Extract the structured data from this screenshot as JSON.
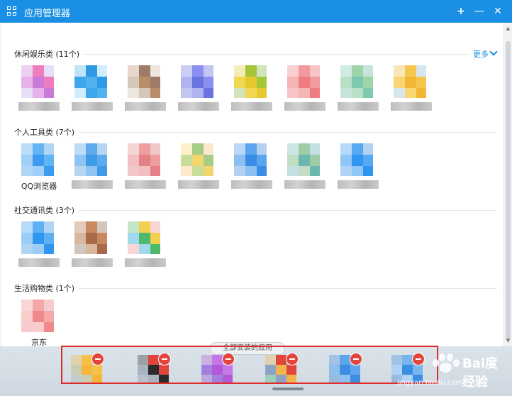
{
  "window": {
    "title": "应用管理器",
    "new_btn": "+",
    "minimize_btn": "—",
    "close_btn": "✕"
  },
  "sections": [
    {
      "title": "休闲娱乐类 (11个)",
      "more": "更多",
      "apps": [
        {
          "label": "",
          "palette": [
            "#c97ad6",
            "#f07cc0",
            "#b9a0e8",
            "#e8b0ea"
          ]
        },
        {
          "label": "",
          "palette": [
            "#4fb3ee",
            "#2e9ae6",
            "#7cc8f5",
            "#3da6ec"
          ]
        },
        {
          "label": "",
          "palette": [
            "#b98d6a",
            "#9d7b66",
            "#cab6a4",
            "#d4c6b9"
          ]
        },
        {
          "label": "",
          "palette": [
            "#6a74e0",
            "#8a8ff0",
            "#4f5dd8",
            "#b0b5f2"
          ]
        },
        {
          "label": "",
          "palette": [
            "#e6c830",
            "#a3c63a",
            "#7db33a",
            "#f2d850"
          ]
        },
        {
          "label": "",
          "palette": [
            "#ee7c80",
            "#f29a9c",
            "#e85a64",
            "#f5b5b5"
          ]
        },
        {
          "label": "",
          "palette": [
            "#7ec8b0",
            "#9ed4a8",
            "#5fb39b",
            "#b8e0c4"
          ]
        },
        {
          "label": "",
          "palette": [
            "#f2b735",
            "#f4c84e",
            "#8fb8cf",
            "#f8d674"
          ]
        }
      ]
    },
    {
      "title": "个人工具类 (7个)",
      "apps": [
        {
          "label": "QQ浏览器",
          "palette": [
            "#3a9bef",
            "#62b4f4",
            "#1d84e6",
            "#9fd0f8"
          ]
        },
        {
          "label": "",
          "palette": [
            "#3f9be8",
            "#5cabee",
            "#2e86d8",
            "#8fc3f2"
          ]
        },
        {
          "label": "",
          "palette": [
            "#e58086",
            "#ef9ea0",
            "#db5f68",
            "#f4bfc0"
          ]
        },
        {
          "label": "",
          "palette": [
            "#f2d66a",
            "#a6cc88",
            "#f0c46a",
            "#c9dd9a"
          ]
        },
        {
          "label": "",
          "palette": [
            "#3a8de4",
            "#5aa5ee",
            "#2a78d4",
            "#8cc0f2"
          ]
        },
        {
          "label": "",
          "palette": [
            "#6ab8b0",
            "#9fcca4",
            "#4fa3a8",
            "#c2ddc4"
          ]
        },
        {
          "label": "",
          "palette": [
            "#2f95ee",
            "#55aaf2",
            "#1c82e0",
            "#8ec6f6"
          ]
        }
      ]
    },
    {
      "title": "社交通讯类 (3个)",
      "apps": [
        {
          "label": "",
          "palette": [
            "#2f95ee",
            "#5eb0f4",
            "#1f84e2",
            "#9ccdf8"
          ]
        },
        {
          "label": "",
          "palette": [
            "#a86a48",
            "#c9885e",
            "#7d5b48",
            "#d7b89c"
          ]
        },
        {
          "label": "",
          "palette": [
            "#4fb86a",
            "#f2d050",
            "#ee8a8a",
            "#9fd8ef"
          ]
        }
      ]
    },
    {
      "title": "生活购物类 (1个)",
      "apps": [
        {
          "label": "京东",
          "palette": [
            "#ef8a8a",
            "#f4a8a8",
            "#e86a70",
            "#f9cccc"
          ]
        }
      ]
    }
  ],
  "installed_btn": "全部安装的应用",
  "pinned_apps": [
    {
      "palette": [
        "#f6b63b",
        "#f4c24a",
        "#a7b2a0",
        "#c9cdb2"
      ]
    },
    {
      "palette": [
        "#2b2b2b",
        "#e2453c",
        "#8a8ea0",
        "#a7b3c1"
      ]
    },
    {
      "palette": [
        "#b05ad8",
        "#c378e6",
        "#8e4bd0",
        "#a37fe0"
      ]
    },
    {
      "palette": [
        "#f0b54a",
        "#e2453c",
        "#3fb36f",
        "#8fa1c4"
      ]
    },
    {
      "palette": [
        "#3d8de0",
        "#5fa5ec",
        "#2a7ad2",
        "#90bfee"
      ]
    },
    {
      "palette": [
        "#3a8de4",
        "#7ab6ee",
        "#2a78d4",
        "#b0d2f4"
      ]
    }
  ],
  "watermark": {
    "text": "Bai度经验",
    "url": "jingyan.baidu.com"
  }
}
